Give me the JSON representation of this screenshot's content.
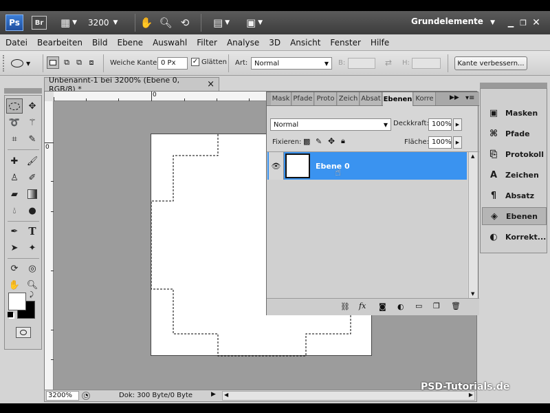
{
  "app": {
    "logo": "Ps",
    "bridge": "Br",
    "zoom_display": "3200",
    "workspace": "Grundelemente"
  },
  "menu": [
    "Datei",
    "Bearbeiten",
    "Bild",
    "Ebene",
    "Auswahl",
    "Filter",
    "Analyse",
    "3D",
    "Ansicht",
    "Fenster",
    "Hilfe"
  ],
  "options": {
    "feather_label": "Weiche Kante:",
    "feather_value": "0 Px",
    "antialias_label": "Glätten",
    "antialias_checked": true,
    "style_label": "Art:",
    "style_value": "Normal",
    "width_label": "B:",
    "height_label": "H:",
    "refine_button": "Kante verbessern..."
  },
  "document": {
    "tab_title": "Unbenannt-1 bei 3200% (Ebene 0, RGB/8) *",
    "close": "×",
    "ruler_h_zero": "0",
    "ruler_v_zero": "0",
    "status_zoom": "3200%",
    "status_info": "Dok: 300 Byte/0 Byte"
  },
  "panel": {
    "tabs": [
      "Mask",
      "Pfade",
      "Proto",
      "Zeich",
      "Absat",
      "Ebenen",
      "Korre"
    ],
    "active_tab": "Ebenen",
    "blend_mode": "Normal",
    "opacity_label": "Deckkraft:",
    "opacity_value": "100%",
    "lock_label": "Fixieren:",
    "fill_label": "Fläche:",
    "fill_value": "100%",
    "layer_name": "Ebene 0"
  },
  "dock": [
    {
      "label": "Masken",
      "icon": "masks-icon"
    },
    {
      "label": "Pfade",
      "icon": "paths-icon"
    },
    {
      "label": "Protokoll",
      "icon": "history-icon"
    },
    {
      "label": "Zeichen",
      "icon": "character-icon"
    },
    {
      "label": "Absatz",
      "icon": "paragraph-icon"
    },
    {
      "label": "Ebenen",
      "icon": "layers-icon"
    },
    {
      "label": "Korrekt...",
      "icon": "adjustments-icon"
    }
  ],
  "watermark": "PSD-Tutorials.de",
  "colors": {
    "titlebar": "#4a4a4a",
    "selection_blue": "#3a93f0",
    "canvas_bg": "#9c9c9c"
  }
}
